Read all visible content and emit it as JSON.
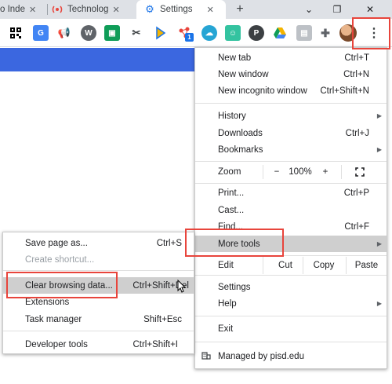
{
  "tabs": [
    {
      "label": "o Inde",
      "icon": "page-icon",
      "active": false
    },
    {
      "label": "Technolog",
      "icon": "broadcast-icon",
      "active": false
    },
    {
      "label": "Settings",
      "icon": "gear-icon",
      "active": true
    }
  ],
  "colors": {
    "accent_blue": "#3b67e0",
    "highlight_red": "#e8453c",
    "hover_gray": "#cfcfcf"
  },
  "toolbar": {
    "extensions": [
      "qr-code-icon",
      "translate-icon",
      "megaphone-icon",
      "w-circle-icon",
      "classroom-icon",
      "scissors-icon",
      "edpuzzle-icon",
      "nodes-icon",
      "cloud-sync-icon",
      "keep-icon",
      "pinterest-icon",
      "drive-icon",
      "extension-gray-icon",
      "puzzle-icon"
    ],
    "badge_count": "1"
  },
  "menu": {
    "new_tab": {
      "label": "New tab",
      "shortcut": "Ctrl+T"
    },
    "new_window": {
      "label": "New window",
      "shortcut": "Ctrl+N"
    },
    "new_incognito": {
      "label": "New incognito window",
      "shortcut": "Ctrl+Shift+N"
    },
    "history": {
      "label": "History"
    },
    "downloads": {
      "label": "Downloads",
      "shortcut": "Ctrl+J"
    },
    "bookmarks": {
      "label": "Bookmarks"
    },
    "zoom": {
      "label": "Zoom",
      "minus": "−",
      "value": "100%",
      "plus": "+"
    },
    "print": {
      "label": "Print...",
      "shortcut": "Ctrl+P"
    },
    "cast": {
      "label": "Cast..."
    },
    "find": {
      "label": "Find...",
      "shortcut": "Ctrl+F"
    },
    "more_tools": {
      "label": "More tools"
    },
    "edit": {
      "label": "Edit",
      "cut": "Cut",
      "copy": "Copy",
      "paste": "Paste"
    },
    "settings": {
      "label": "Settings"
    },
    "help": {
      "label": "Help"
    },
    "exit": {
      "label": "Exit"
    },
    "managed": {
      "label": "Managed by pisd.edu"
    }
  },
  "submenu": {
    "save_page": {
      "label": "Save page as...",
      "shortcut": "Ctrl+S"
    },
    "create_shortcut": {
      "label": "Create shortcut..."
    },
    "clear_browsing": {
      "label": "Clear browsing data...",
      "shortcut": "Ctrl+Shift+Del"
    },
    "extensions": {
      "label": "Extensions"
    },
    "task_manager": {
      "label": "Task manager",
      "shortcut": "Shift+Esc"
    },
    "developer_tools": {
      "label": "Developer tools",
      "shortcut": "Ctrl+Shift+I"
    }
  }
}
